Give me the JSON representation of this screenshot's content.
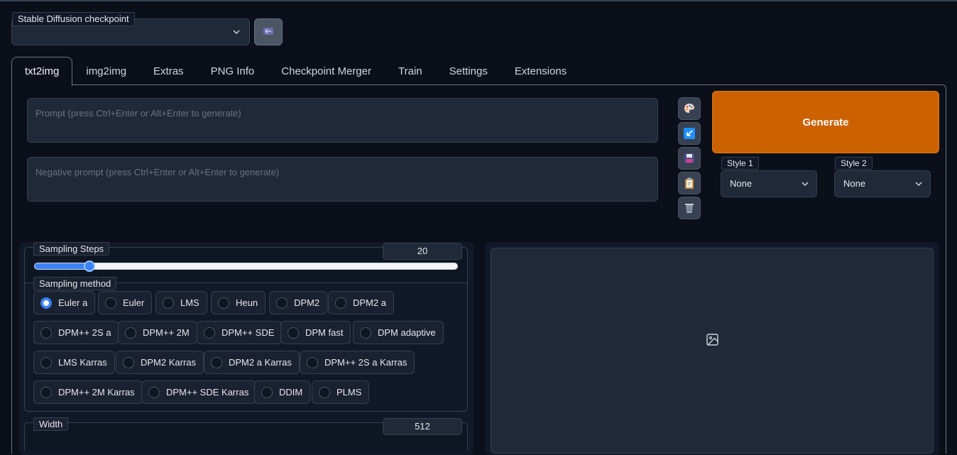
{
  "checkpoint": {
    "label": "Stable Diffusion checkpoint",
    "value": ""
  },
  "tabs": [
    {
      "label": "txt2img",
      "active": true
    },
    {
      "label": "img2img"
    },
    {
      "label": "Extras"
    },
    {
      "label": "PNG Info"
    },
    {
      "label": "Checkpoint Merger"
    },
    {
      "label": "Train"
    },
    {
      "label": "Settings"
    },
    {
      "label": "Extensions"
    }
  ],
  "prompt": {
    "placeholder": "Prompt (press Ctrl+Enter or Alt+Enter to generate)",
    "value": ""
  },
  "negative_prompt": {
    "placeholder": "Negative prompt (press Ctrl+Enter or Alt+Enter to generate)",
    "value": ""
  },
  "tools": [
    "palette-icon",
    "arrow-checkbox-icon",
    "save-icon",
    "clipboard-icon",
    "trash-icon"
  ],
  "generate": {
    "label": "Generate"
  },
  "styles": [
    {
      "label": "Style 1",
      "value": "None"
    },
    {
      "label": "Style 2",
      "value": "None"
    }
  ],
  "sampling_steps": {
    "label": "Sampling Steps",
    "value": "20",
    "fraction": 0.13
  },
  "sampling_method": {
    "label": "Sampling method",
    "selected": "Euler a",
    "options": [
      "Euler a",
      "Euler",
      "LMS",
      "Heun",
      "DPM2",
      "DPM2 a",
      "DPM++ 2S a",
      "DPM++ 2M",
      "DPM++ SDE",
      "DPM fast",
      "DPM adaptive",
      "LMS Karras",
      "DPM2 Karras",
      "DPM2 a Karras",
      "DPM++ 2S a Karras",
      "DPM++ 2M Karras",
      "DPM++ SDE Karras",
      "DDIM",
      "PLMS"
    ]
  },
  "width": {
    "label": "Width",
    "value": "512"
  },
  "colors": {
    "accent": "#3b82f6",
    "generate": "#cc6100",
    "background": "#0b0f19"
  }
}
